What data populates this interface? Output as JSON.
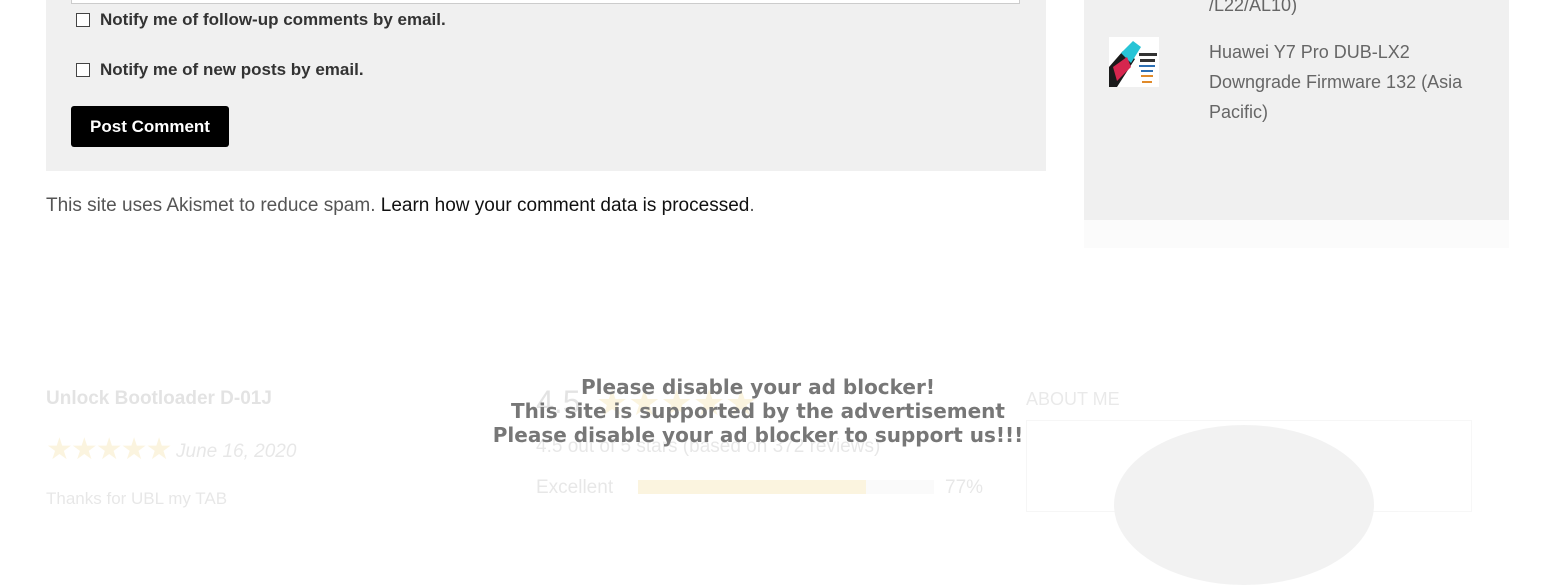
{
  "comment_form": {
    "notify_followup_label": "Notify me of follow-up comments by email.",
    "notify_posts_label": "Notify me of new posts by email.",
    "post_button_label": "Post Comment"
  },
  "akismet": {
    "prefix": "This site uses Akismet to reduce spam.",
    "link_text": "Learn how your comment data is processed",
    "suffix": "."
  },
  "sidebar": {
    "partial_item_text": "/L22/AL10)",
    "items": [
      {
        "title_line1": "Huawei Y7 Pro DUB-LX2",
        "title_line2": "Downgrade Firmware 132 (Asia",
        "title_line3": "Pacific)",
        "thumb_icon": "firmware-thumbnail-icon"
      }
    ]
  },
  "footer": {
    "review_title": "Unlock Bootloader D-01J",
    "review_stars": "★★★★★",
    "review_date": "June 16, 2020",
    "review_text": "Thanks for UBL my TAB",
    "rating_value": "4.5",
    "rating_stars": "★★★★★",
    "rating_summary": "4.5 out of 5 stars (based on 372 reviews)",
    "breakdown": [
      {
        "label": "Excellent",
        "percent_text": "77%",
        "fraction": 0.77
      }
    ],
    "about_heading": "ABOUT ME"
  },
  "adblock_notice": {
    "line1": "Please disable your ad blocker!",
    "line2": "This site is supported by the advertisement",
    "line3": "Please disable your ad blocker to support us!!!"
  },
  "colors": {
    "button_bg": "#000000",
    "panel_bg": "#f0f0f0",
    "star_color": "#e0a800"
  }
}
